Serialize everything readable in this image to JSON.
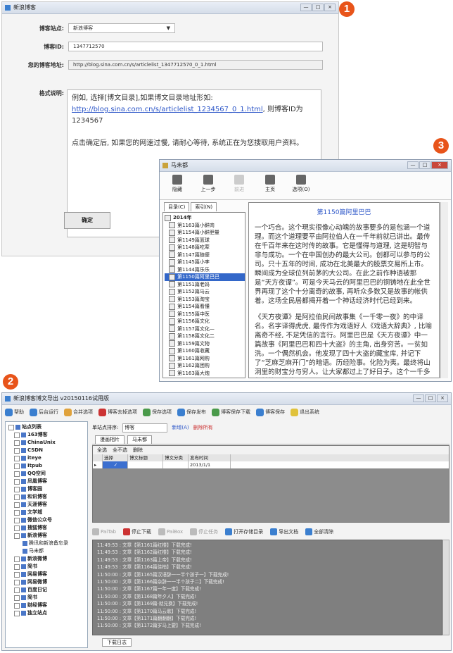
{
  "badges": {
    "one": "1",
    "two": "2",
    "three": "3"
  },
  "win1": {
    "title": "新浪博客",
    "controls": {
      "min": "—",
      "max": "□",
      "close": "×"
    },
    "fields": [
      {
        "label": "博客站点:",
        "value": "新浪博客"
      },
      {
        "label": "博客ID:",
        "value": "1347712570"
      },
      {
        "label": "您的博客地址:",
        "value": "http://blog.sina.com.cn/s/articlelist_1347712570_0_1.html"
      }
    ],
    "desc_label": "格式说明:",
    "desc_line1": "例如, 选择[博文目录],如果博文目录地址形如:",
    "desc_link": "http://blog.sina.com.cn/s/articlelist_1234567_0_1.html",
    "desc_line2": ", 则博客ID为1234567",
    "desc_line3": "点击确定后, 如果您的网速过慢, 请耐心等待, 系统正在为您搜取用户资料。",
    "ok": "确定"
  },
  "win3": {
    "title": "马未都",
    "tools": [
      {
        "label": "隐藏",
        "enabled": true
      },
      {
        "label": "上一步",
        "enabled": true
      },
      {
        "label": "前进",
        "enabled": false
      },
      {
        "label": "主页",
        "enabled": true
      },
      {
        "label": "选项(O)",
        "enabled": true
      }
    ],
    "tabs": [
      "目录(C)",
      "索引(N)"
    ],
    "tree_root": "2014年",
    "tree_items": [
      "第1163篇小鲜肉",
      "第1154篇小鲜胆量",
      "第1149篇篮球",
      "第1148篇吃荤",
      "第1147篇随便",
      "第1145篇小李",
      "第1144篇乐乐",
      "第1150篇阿里巴巴",
      "第1151篇老妈",
      "第1152篇马云",
      "第1153篇淘宝",
      "第1154篇看懂",
      "第1155篇中医",
      "第1156篇文化",
      "第1157篇文化—",
      "第1158篇文化二",
      "第1159篇文物",
      "第1160篇收藏",
      "第1161篇网购",
      "第1162篇团购",
      "第1163篇大炮",
      "第1164篇马上",
      "第1165篇时光"
    ],
    "selected_index": 7,
    "content_title": "第1150篇阿里巴巴",
    "para1": "一个巧合。这个現实很像心动魄的故事要多的是包涵一个道理。而这个道理要平由阿拉伯人在一千年前就已讲出。最传在千百年来在这时传的故事。它是懂得与道理, 这是明智与非与成功。一个在中国创办的最大公司。创都可以参与的公司。只十五年的时间, 成功在北美最大的股票交易所上市。瞬间成为全球位列前茅的大公司。在此之前作种语被那是“天方夜谭”。可是今天马云的阿里巴巴的铜铸地在此全世界再现了这个十分离奇的故事, 再听众多数又是故事的帐供着。这场全民居都揭开着一个神话经济时代已经到来。",
    "para2": "《天方夜谭》是阿拉伯民间故事集《一千零一夜》的中译名。名字译得虎虎, 最传作为戏语好人《戏语大辞典》, 比喻离奇不经, 不足凭信的言行。阿里巴巴是《天方夜谭》中一篇故事《阿里巴巴和四十大盗》的主角, 出身穷苦。一贫如洗。一个偶然机会。他发现了四十大盗的藏宝库, 并记下了“芝麻芝麻开门”的暗语。历经险事。化险为夷。最终将山洞里的财宝分与穷人。让大家都过上了好日子。这个一千多年前的阿拉伯"
  },
  "win2": {
    "title": "新浪博客博文导出 v20150116试用版",
    "controls": {
      "min": "—",
      "max": "□",
      "close": "×"
    },
    "toolbar": [
      "帮助",
      "后台运行",
      "合并选项",
      "博客去掉选项",
      "保存选项",
      "保存发布",
      "博客保存下载",
      "博客保存",
      "退出系统"
    ],
    "tree": [
      {
        "label": "站点列表",
        "level": 0
      },
      {
        "label": "163博客",
        "level": 1
      },
      {
        "label": "ChinaUnix",
        "level": 1
      },
      {
        "label": "CSDN",
        "level": 1
      },
      {
        "label": "iteye",
        "level": 1
      },
      {
        "label": "Itpub",
        "level": 1
      },
      {
        "label": "QQ空间",
        "level": 1
      },
      {
        "label": "凤凰博客",
        "level": 1
      },
      {
        "label": "博客园",
        "level": 1
      },
      {
        "label": "和讯博客",
        "level": 1
      },
      {
        "label": "天涯博客",
        "level": 1
      },
      {
        "label": "文学城",
        "level": 1
      },
      {
        "label": "微信公众号",
        "level": 1
      },
      {
        "label": "搜狐博客",
        "level": 1
      },
      {
        "label": "新浪博客",
        "level": 1
      },
      {
        "label": "腾讯和新浪备忘录",
        "level": 2
      },
      {
        "label": "马未都",
        "level": 2
      },
      {
        "label": "新浪微博",
        "level": 1
      },
      {
        "label": "简书",
        "level": 1
      },
      {
        "label": "网易博客",
        "level": 1
      },
      {
        "label": "网易微博",
        "level": 1
      },
      {
        "label": "百度日记",
        "level": 1
      },
      {
        "label": "简书",
        "level": 1
      },
      {
        "label": "财经博客",
        "level": 1
      },
      {
        "label": "独立站点",
        "level": 1
      }
    ],
    "filter_label": "单站点排序:",
    "filter_value": "博客",
    "filter_btn1": "新增(A)",
    "filter_btn2": "删除所有",
    "panel_tabs": [
      "漫画相片",
      "马未都"
    ],
    "grid_filters": [
      "全选",
      "全不选",
      "删除"
    ],
    "grid_cols": [
      "选择",
      "博文标题",
      "博文分类",
      "发布时间"
    ],
    "grid_row": {
      "mark": "▸",
      "check": "✓",
      "title": "",
      "cat": "",
      "date": "2013/1/1"
    },
    "log_tools": [
      {
        "label": "PaiTab",
        "on": false
      },
      {
        "label": "停止下载",
        "on": true
      },
      {
        "label": "PaiBox",
        "on": false
      },
      {
        "label": "停止任务",
        "on": false
      },
      {
        "label": "打开存储目录",
        "on": true
      },
      {
        "label": "导出文档",
        "on": true
      },
      {
        "label": "全部清除",
        "on": true
      }
    ],
    "log_lines": [
      "11:49:53 : 文章【第1161篇红楼】下载完成!",
      "11:49:53 : 文章【第1162篇红楼】下载完成!",
      "11:49:53 : 文章【第1163篇上帝】下载完成!",
      "11:49:53 : 文章【第1164篇佳柏】下载完成!",
      "11:50:00 : 文章【第1165篇汉语辞一一半个孩子一】下载完成!",
      "11:50:00 : 文章【第1166篇杂辞一一半个孩子二】下载完成!",
      "11:50:00 : 文章【第1167篇一年一度】下载完成!",
      "11:50:00 : 文章【第1168篇年夕人】下载完成!",
      "11:50:00 : 文章【第1169篇·就兑换】下载完成!",
      "11:50:00 : 文章【第1170篇马云歌】下载完成!",
      "11:50:00 : 文章【第1171篇翻翻翻】下载完成!",
      "11:50:00 : 文章【第1172篇岁马上要】下载完成!"
    ],
    "bottom_tab": "下载日志"
  }
}
